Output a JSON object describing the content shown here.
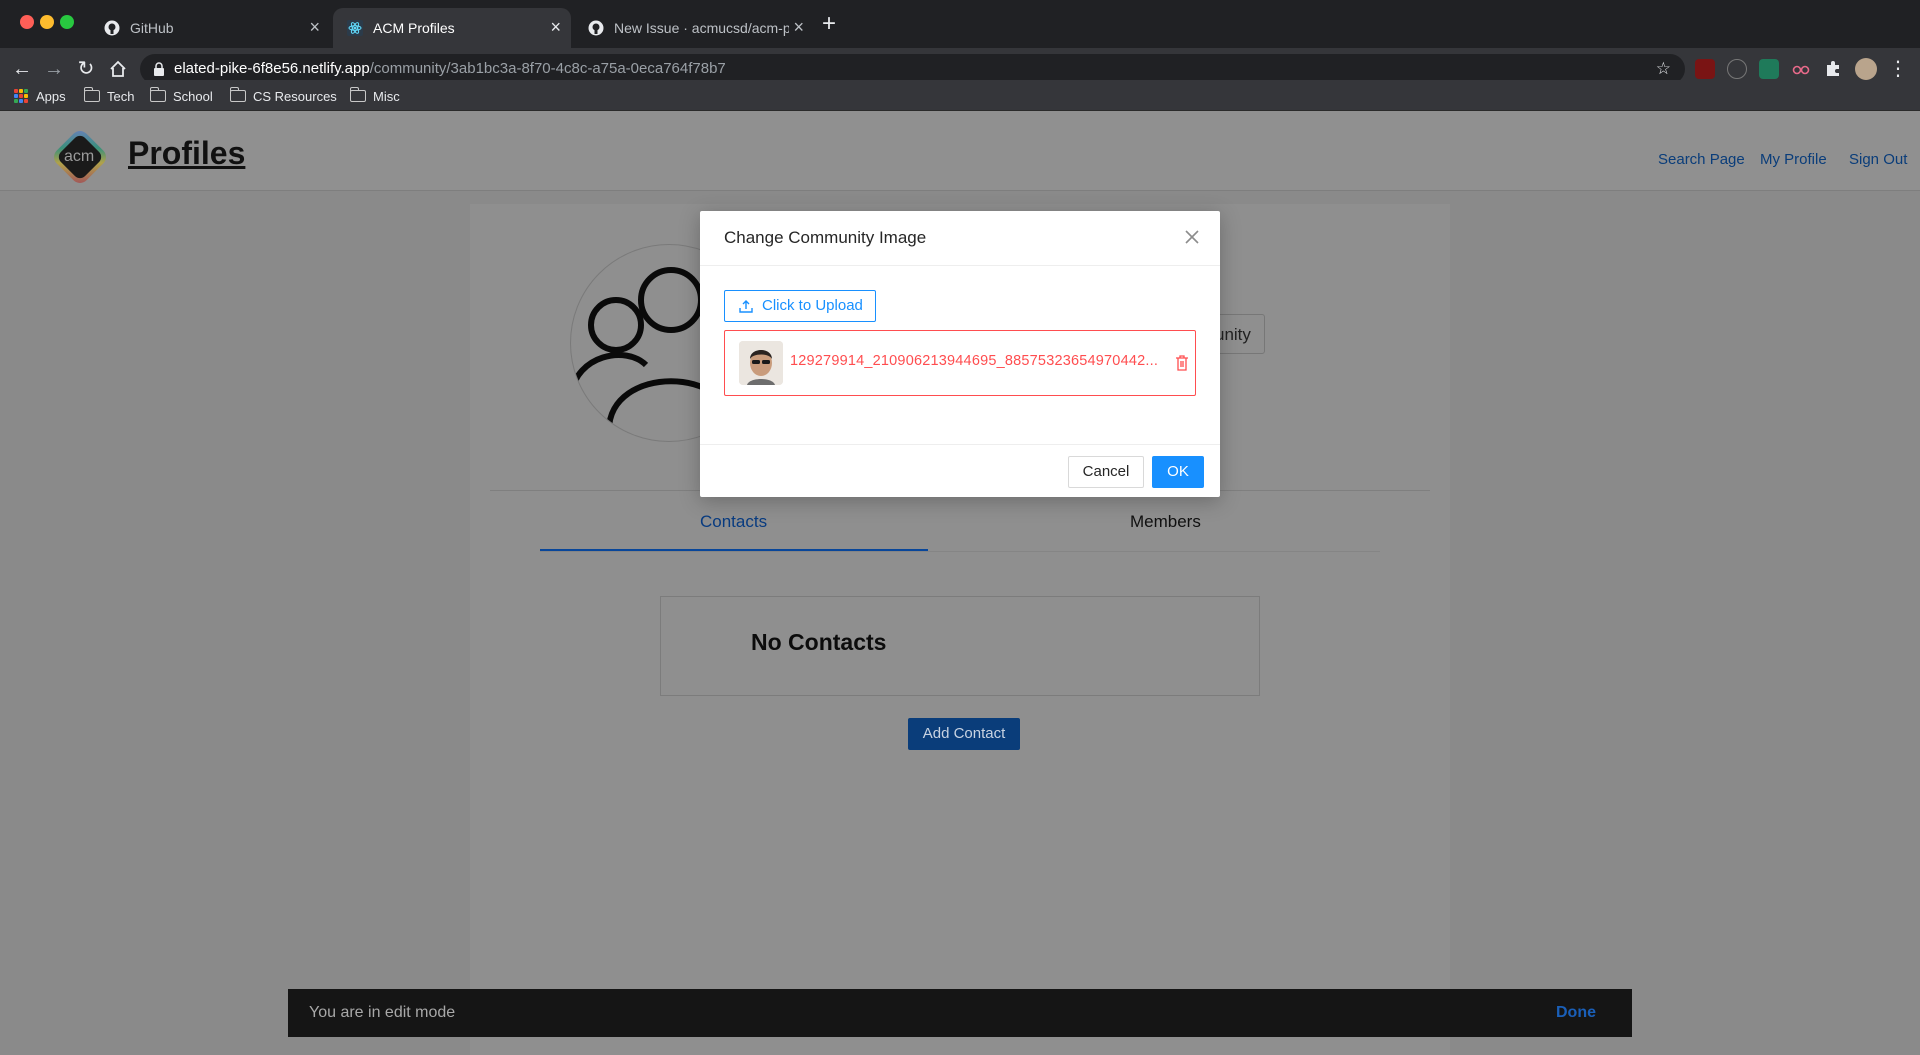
{
  "browser": {
    "tabs": [
      {
        "title": "GitHub",
        "icon": "github-icon"
      },
      {
        "title": "ACM Profiles",
        "icon": "react-icon"
      },
      {
        "title": "New Issue · acmucsd/acm-prof",
        "icon": "github-icon"
      }
    ],
    "url_host": "elated-pike-6f8e56.netlify.app",
    "url_path": "/community/3ab1bc3a-8f70-4c8c-a75a-0eca764f78b7",
    "bookmarks": [
      "Apps",
      "Tech",
      "School",
      "CS Resources",
      "Misc"
    ]
  },
  "header": {
    "logo_text": "acm",
    "brand": "Profiles",
    "nav": [
      "Search Page",
      "My Profile",
      "Sign Out"
    ]
  },
  "community": {
    "action_partial": "unity",
    "tabs": [
      "Contacts",
      "Members"
    ],
    "empty_message": "No Contacts",
    "add_label": "Add Contact"
  },
  "editbar": {
    "message": "You are in edit mode",
    "done_label": "Done"
  },
  "modal": {
    "title": "Change Community Image",
    "upload_label": "Click to Upload",
    "file_name": "129279914_210906213944695_88575323654970442...",
    "cancel_label": "Cancel",
    "ok_label": "OK"
  },
  "colors": {
    "primary": "#1890ff",
    "error": "#ff4d4f",
    "link": "#0a3d7a"
  }
}
